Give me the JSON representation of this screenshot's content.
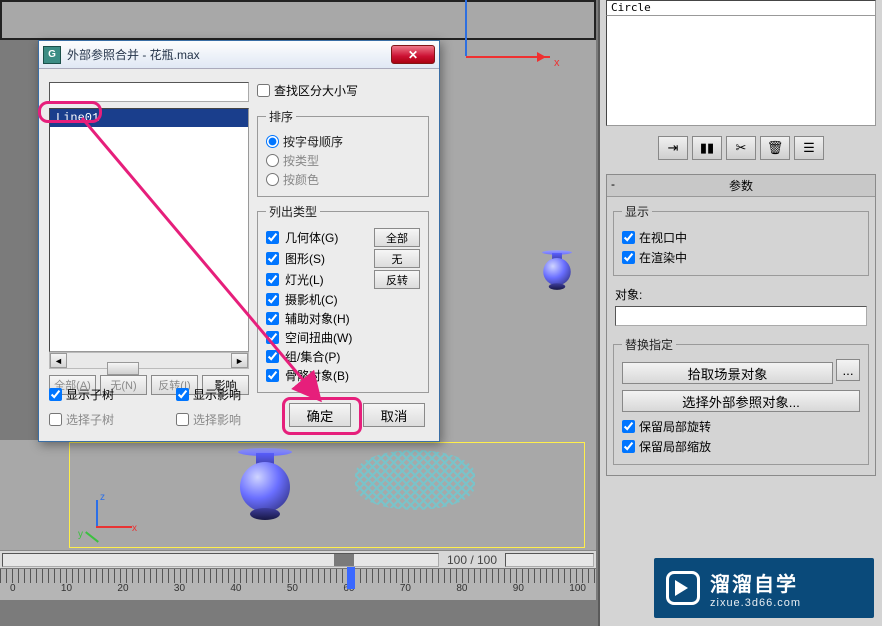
{
  "viewport": {
    "axis_x": "x",
    "axis_y": "y",
    "axis_z": "z",
    "page_info": "100 / 100",
    "ruler_numbers": [
      "0",
      "10",
      "20",
      "30",
      "40",
      "50",
      "60",
      "70",
      "80",
      "90",
      "100"
    ]
  },
  "panel": {
    "object_in_list": "Circle",
    "rollout_params": "参数",
    "display_legend": "显示",
    "chk_in_viewport": "在视口中",
    "chk_in_render": "在渲染中",
    "object_label": "对象:",
    "replace_legend": "替换指定",
    "btn_pick_scene": "拾取场景对象",
    "btn_dots": "...",
    "btn_pick_xref": "选择外部参照对象...",
    "chk_keep_rot": "保留局部旋转",
    "chk_keep_scale": "保留局部缩放"
  },
  "dialog": {
    "title": "外部参照合并 - 花瓶.max",
    "list_item": "Line01",
    "btn_all": "全部(A)",
    "btn_none": "无(N)",
    "btn_invert": "反转(I)",
    "btn_influence": "影响",
    "chk_case": "查找区分大小写",
    "sort_legend": "排序",
    "sort_alpha": "按字母顺序",
    "sort_type": "按类型",
    "sort_color": "按颜色",
    "types_legend": "列出类型",
    "type_geom": "几何体(G)",
    "type_shape": "图形(S)",
    "type_light": "灯光(L)",
    "type_camera": "摄影机(C)",
    "type_helper": "辅助对象(H)",
    "type_warp": "空间扭曲(W)",
    "type_group": "组/集合(P)",
    "type_bone": "骨骼对象(B)",
    "btn_type_all": "全部",
    "btn_type_none": "无",
    "btn_type_invert": "反转",
    "opt_show_subtree": "显示子树",
    "opt_select_subtree": "选择子树",
    "opt_show_influence": "显示影响",
    "opt_select_influence": "选择影响",
    "btn_ok": "确定",
    "btn_cancel": "取消"
  },
  "watermark": {
    "title": "溜溜自学",
    "url": "zixue.3d66.com"
  }
}
